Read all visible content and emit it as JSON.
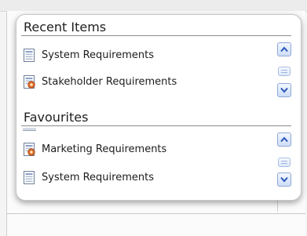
{
  "recent": {
    "title": "Recent Items",
    "items": [
      {
        "label": "System Requirements",
        "icon": "requirements-doc-icon"
      },
      {
        "label": "Stakeholder Requirements",
        "icon": "stakeholder-doc-icon"
      }
    ]
  },
  "favourites": {
    "title": "Favourites",
    "items": [
      {
        "label": "Marketing Requirements",
        "icon": "stakeholder-doc-icon"
      },
      {
        "label": "System Requirements",
        "icon": "requirements-doc-icon"
      }
    ]
  },
  "colors": {
    "accent_orange": "#e0702a",
    "scroll_blue": "#2a55b8"
  }
}
